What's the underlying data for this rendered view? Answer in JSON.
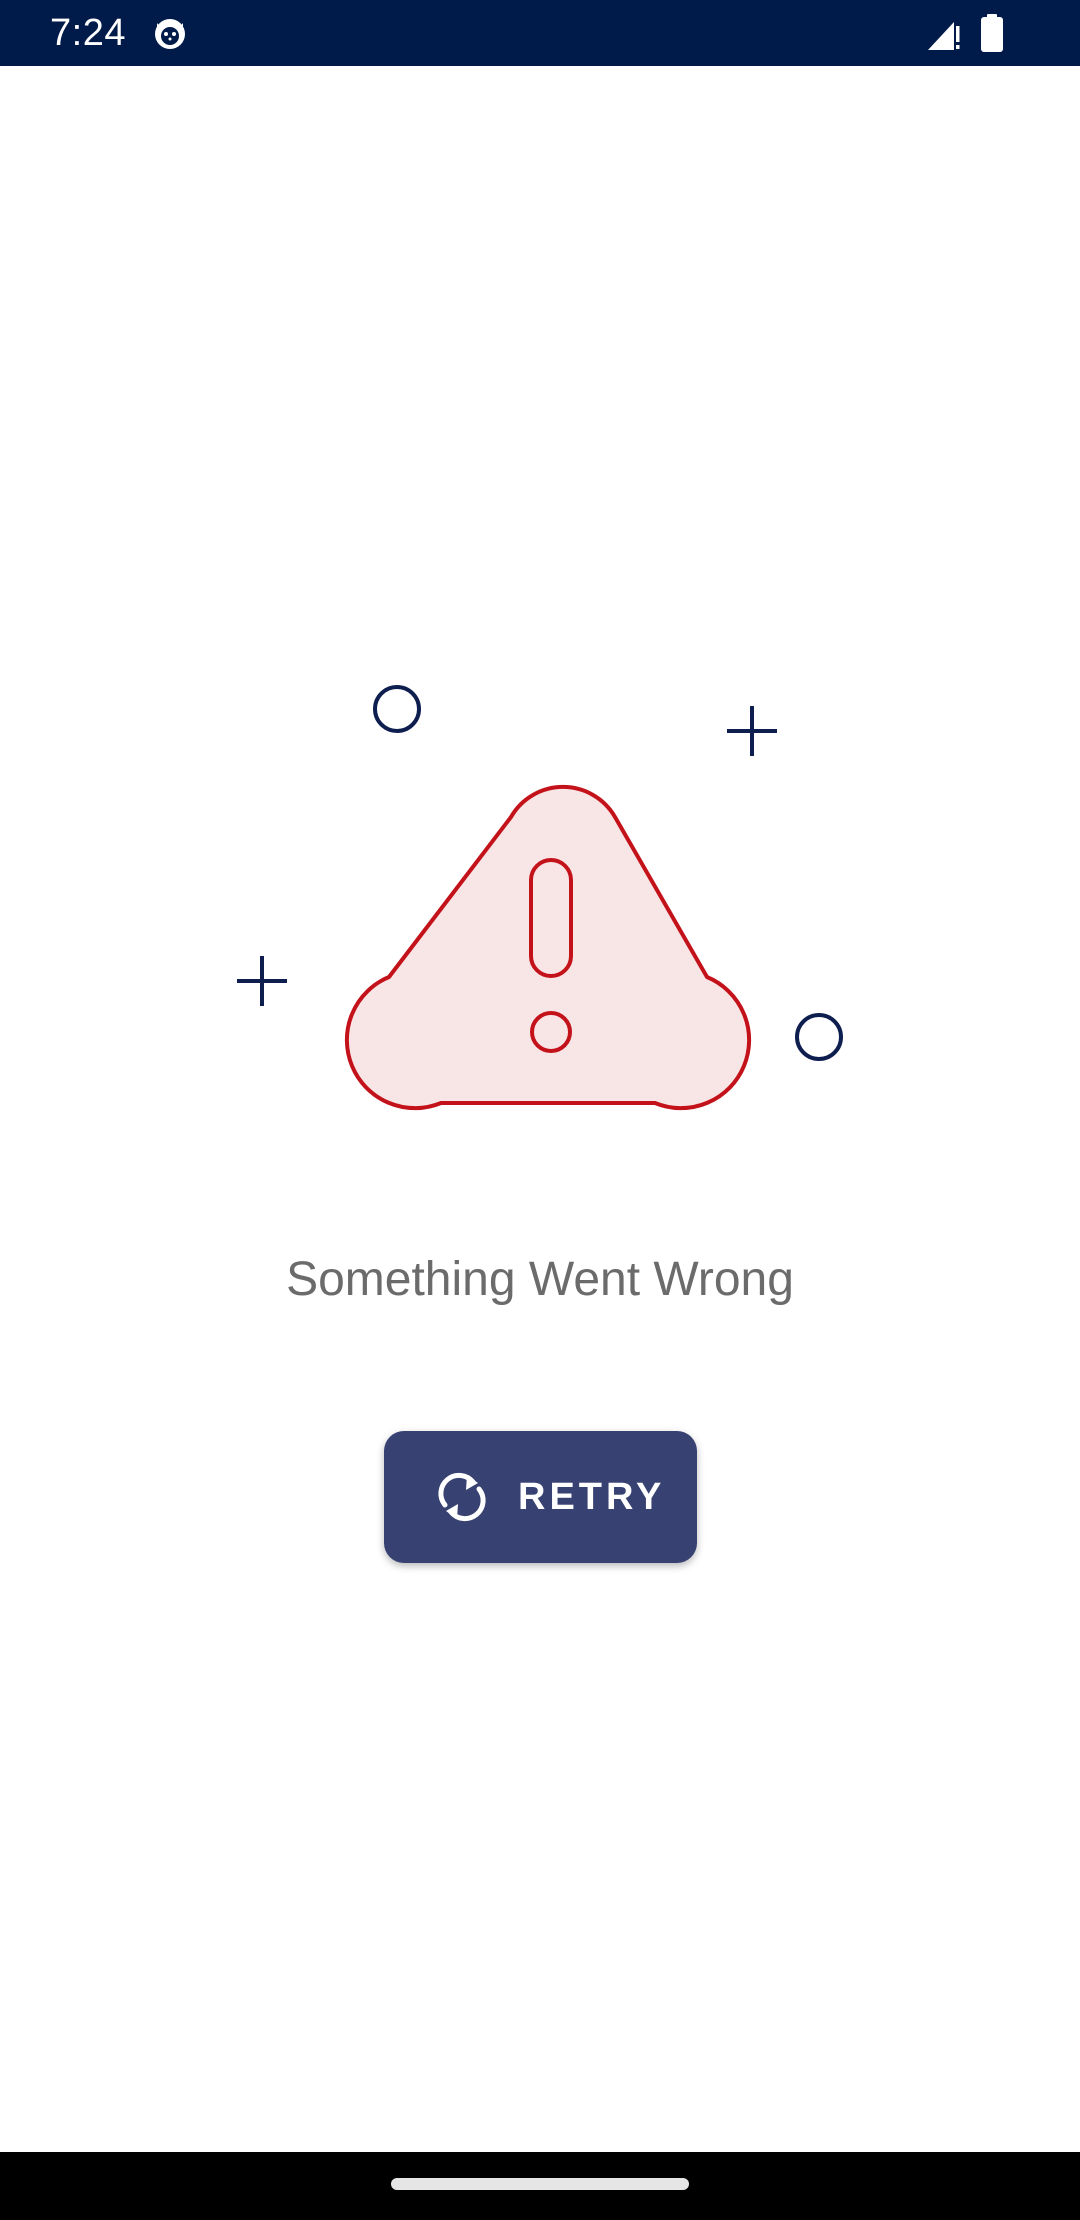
{
  "status_bar": {
    "time": "7:24",
    "app_icon": "cat-face-icon",
    "signal_icon": "cellular-signal-alert-icon",
    "battery_icon": "battery-full-icon",
    "background_color": "#001a4a"
  },
  "error_state": {
    "illustration_icon": "warning-triangle-icon",
    "decoration_icons": [
      "circle-icon",
      "plus-icon",
      "plus-icon",
      "circle-icon"
    ],
    "accent_color": "#c4121a",
    "decoration_color": "#0d1e4f",
    "message": "Something Went Wrong",
    "retry_button": {
      "label": "RETRY",
      "icon": "refresh-icon",
      "background_color": "#374172"
    }
  },
  "nav_bar": {
    "home_handle": "home-gesture-handle"
  }
}
